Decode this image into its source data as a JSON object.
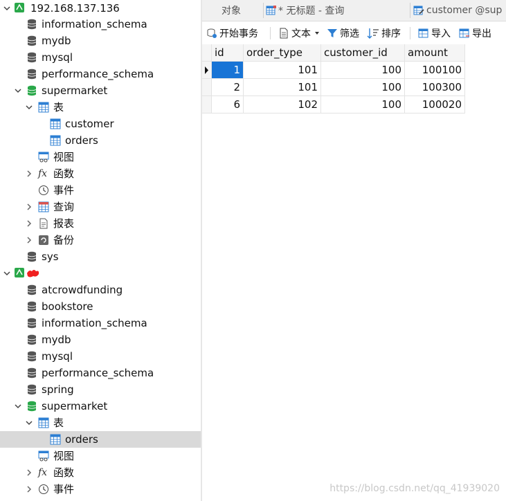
{
  "connections": [
    {
      "name": "192.168.137.136",
      "databases": [
        "information_schema",
        "mydb",
        "mysql",
        "performance_schema"
      ],
      "active_db": {
        "name": "supermarket",
        "tables_label": "表",
        "tables": [
          "customer",
          "orders"
        ],
        "others": [
          "视图",
          "函数",
          "事件",
          "查询",
          "报表",
          "备份"
        ]
      },
      "extra_db": "sys"
    },
    {
      "name": "",
      "databases": [
        "atcrowdfunding",
        "bookstore",
        "information_schema",
        "mydb",
        "mysql",
        "performance_schema",
        "spring"
      ],
      "active_db": {
        "name": "supermarket",
        "tables_label": "表",
        "tables": [
          "orders"
        ],
        "others": [
          "视图",
          "函数",
          "事件"
        ]
      }
    }
  ],
  "tabs": [
    "对象",
    "* 无标题 - 查询",
    "customer @sup"
  ],
  "toolbar": {
    "begin_tx": "开始事务",
    "text": "文本",
    "filter": "筛选",
    "sort": "排序",
    "import": "导入",
    "export": "导出"
  },
  "grid": {
    "columns": [
      "id",
      "order_type",
      "customer_id",
      "amount"
    ],
    "rows": [
      [
        "1",
        "101",
        "100",
        "100100"
      ],
      [
        "2",
        "101",
        "100",
        "100300"
      ],
      [
        "6",
        "102",
        "100",
        "100020"
      ]
    ]
  },
  "watermark": "https://blog.csdn.net/qq_41939020",
  "colors": {
    "selection": "#1874d6",
    "db_icon": "#555555",
    "db_active_icon": "#2aa84a",
    "conn_icon": "#2aa84a"
  }
}
